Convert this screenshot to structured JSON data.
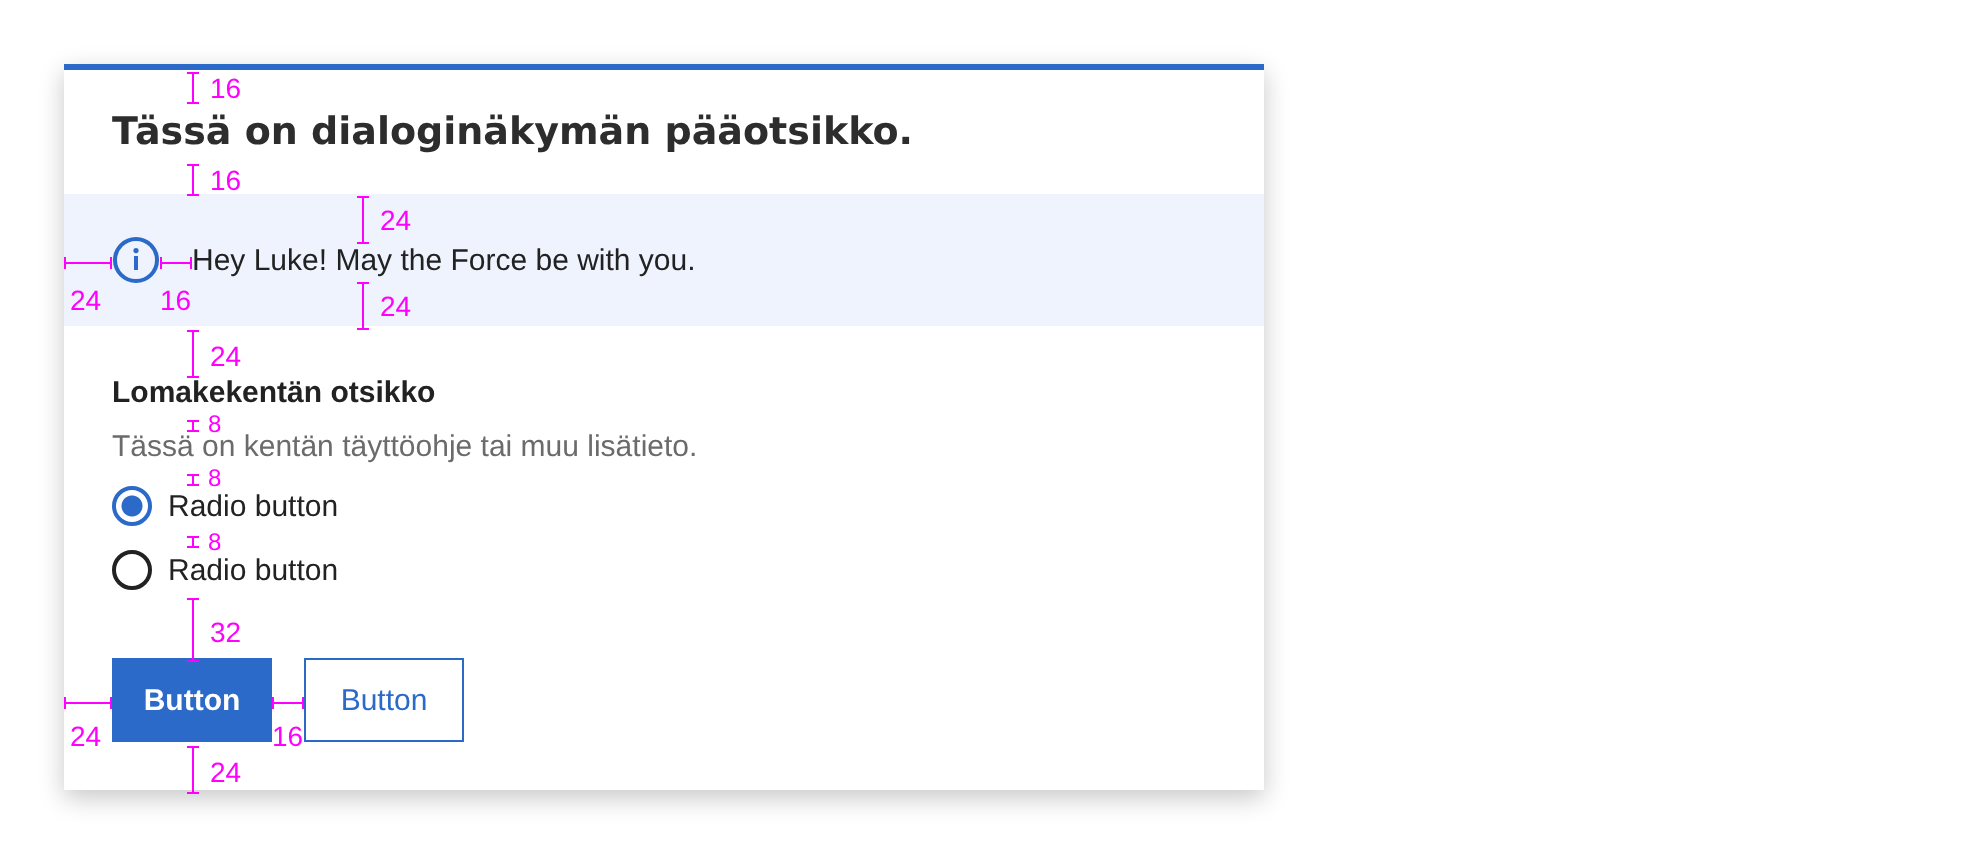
{
  "dialog": {
    "title": "Tässä on dialoginäkymän pääotsikko.",
    "notice": {
      "text": "Hey Luke! May the Force be with you."
    },
    "field": {
      "label": "Lomakekentän otsikko",
      "hint": "Tässä on kentän täyttöohje tai muu lisätieto.",
      "options": [
        {
          "label": "Radio button",
          "selected": true
        },
        {
          "label": "Radio button",
          "selected": false
        }
      ]
    },
    "buttons": [
      {
        "label": "Button",
        "kind": "primary"
      },
      {
        "label": "Button",
        "kind": "secondary"
      }
    ]
  },
  "measurements": [
    {
      "label": "16",
      "kind": "vertical"
    },
    {
      "label": "16",
      "kind": "vertical"
    },
    {
      "label": "24",
      "kind": "vertical"
    },
    {
      "label": "24",
      "kind": "horizontal"
    },
    {
      "label": "16",
      "kind": "horizontal"
    },
    {
      "label": "24",
      "kind": "vertical"
    },
    {
      "label": "24",
      "kind": "vertical"
    },
    {
      "label": "8",
      "kind": "vertical"
    },
    {
      "label": "8",
      "kind": "vertical"
    },
    {
      "label": "8",
      "kind": "vertical"
    },
    {
      "label": "32",
      "kind": "vertical"
    },
    {
      "label": "24",
      "kind": "horizontal"
    },
    {
      "label": "16",
      "kind": "horizontal"
    },
    {
      "label": "24",
      "kind": "vertical"
    }
  ]
}
